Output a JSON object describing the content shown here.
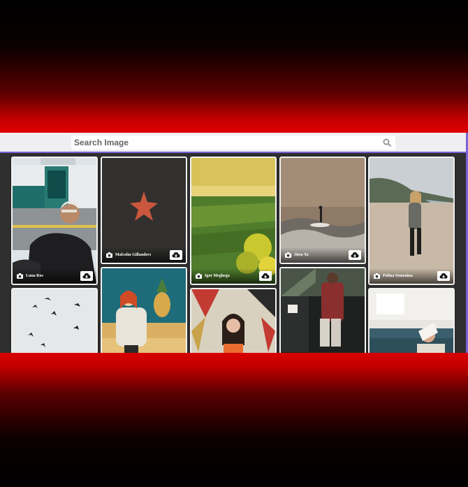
{
  "search": {
    "placeholder": "Search Image"
  },
  "gallery": {
    "col1": [
      {
        "author": "Luna Ros"
      },
      {
        "author": ""
      }
    ],
    "col2": [
      {
        "author": "Malcolm Gillanders"
      },
      {
        "author": ""
      }
    ],
    "col3": [
      {
        "author": "Igor Meghega"
      },
      {
        "author": ""
      }
    ],
    "col4": [
      {
        "author": "Jiten Ya"
      },
      {
        "author": ""
      }
    ],
    "col5": [
      {
        "author": "Polina Semenina"
      },
      {
        "author": ""
      }
    ]
  },
  "colors": {
    "accent": "#7b62d6",
    "glow": "#e00000"
  }
}
